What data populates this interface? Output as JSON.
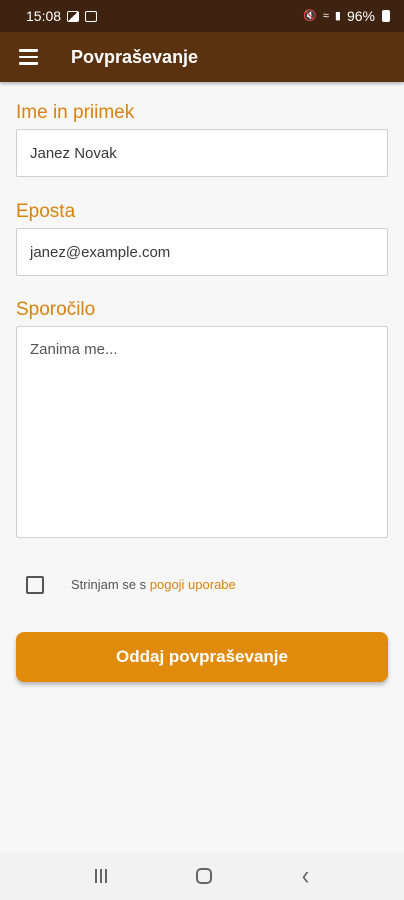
{
  "status_bar": {
    "time": "15:08",
    "battery": "96%",
    "icons": [
      "image-icon",
      "notification-icon",
      "mute-icon",
      "wifi-icon",
      "signal-icon",
      "battery-icon"
    ]
  },
  "app_bar": {
    "menu_icon": "hamburger-icon",
    "title": "Povpraševanje"
  },
  "form": {
    "name_label": "Ime in priimek",
    "name_value": "Janez Novak",
    "email_label": "Eposta",
    "email_value": "janez@example.com",
    "message_label": "Sporočilo",
    "message_value": "Zanima me...",
    "terms_prefix": "Strinjam se s ",
    "terms_link": "pogoji uporabe",
    "terms_checked": false,
    "submit_label": "Oddaj povpraševanje"
  },
  "colors": {
    "status_bar": "#3e2310",
    "app_bar": "#5b3210",
    "accent": "#d9820f",
    "button": "#e08b0c",
    "background": "#f7f7f7"
  },
  "nav_bar": {
    "buttons": [
      "recents-icon",
      "home-icon",
      "back-icon"
    ]
  }
}
